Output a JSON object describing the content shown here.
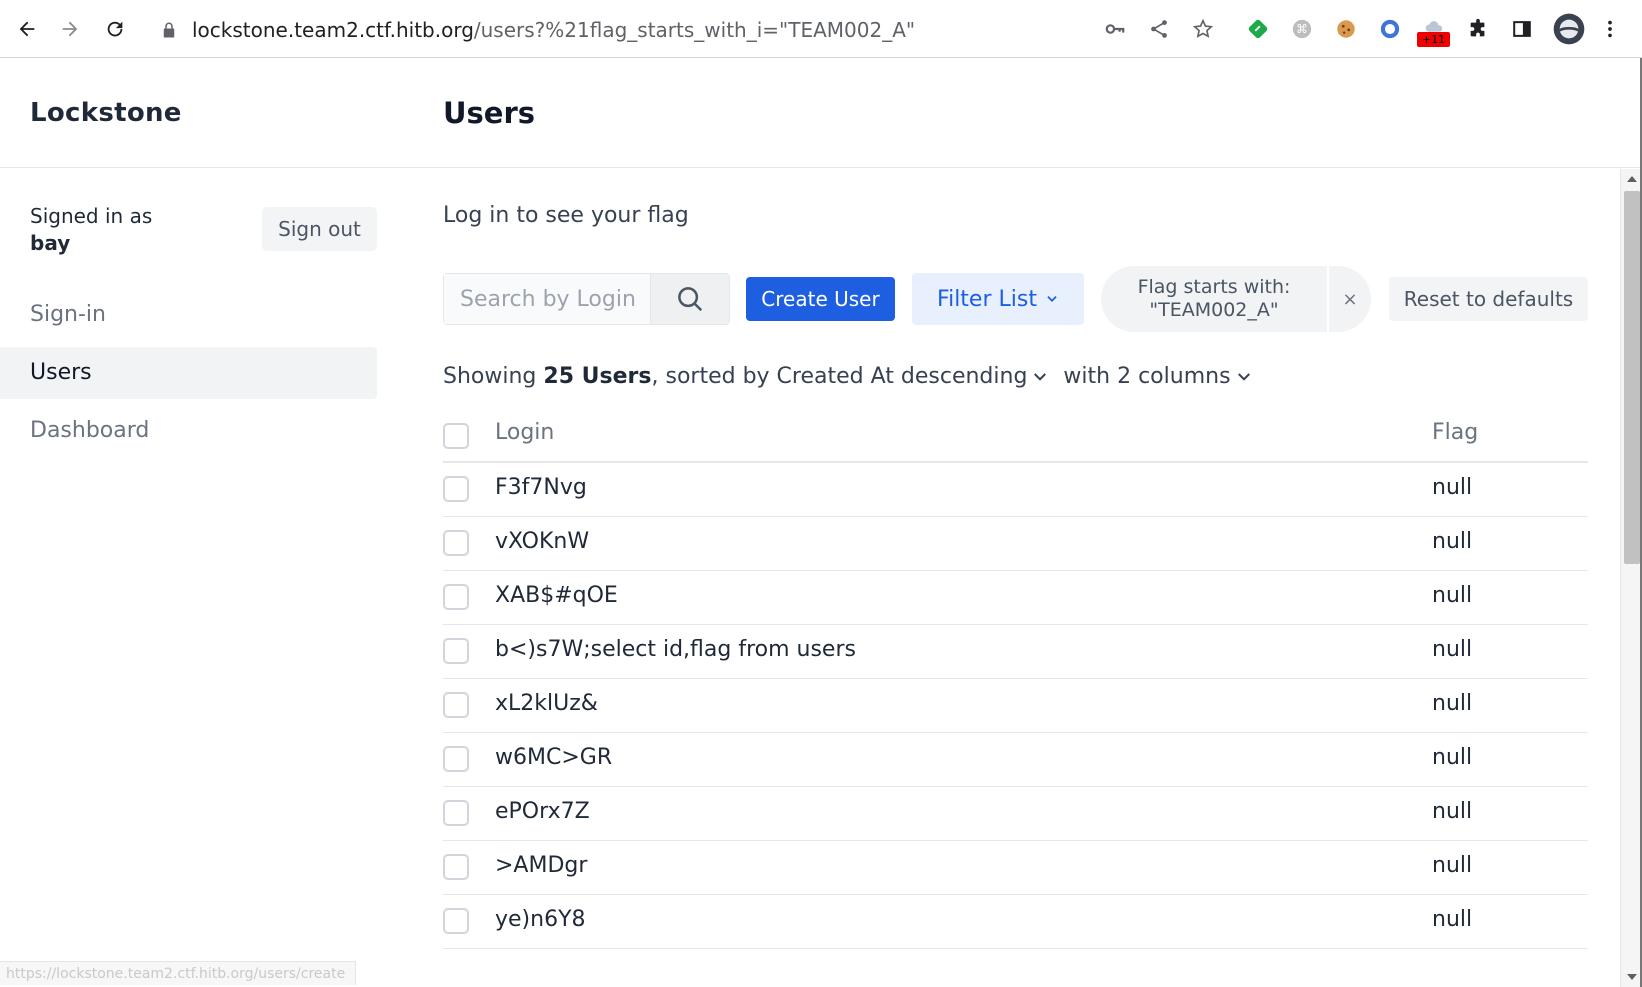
{
  "browser": {
    "url_host": "lockstone.team2.ctf.hitb.org",
    "url_path": "/users?%21flag_starts_with_i=\"TEAM002_A\"",
    "extension_badge": "+11",
    "status_link": "https://lockstone.team2.ctf.hitb.org/users/create"
  },
  "app": {
    "brand": "Lockstone",
    "page_title": "Users"
  },
  "sidebar": {
    "signed_in_prefix": "Signed in as",
    "username": "bay",
    "sign_out_label": "Sign out",
    "items": [
      {
        "label": "Sign-in",
        "active": false
      },
      {
        "label": "Users",
        "active": true
      },
      {
        "label": "Dashboard",
        "active": false
      }
    ]
  },
  "main": {
    "notice": "Log in to see your flag",
    "search_placeholder": "Search by Login",
    "create_label": "Create User",
    "filter_label": "Filter List",
    "filter_chip": {
      "line1": "Flag starts with:",
      "line2": "\"TEAM002_A\"",
      "remove": "×"
    },
    "reset_label": "Reset to defaults",
    "summary": {
      "prefix": "Showing",
      "count": "25 Users",
      "sort_text": ", sorted by Created At descending",
      "columns_text": "with 2 columns"
    }
  },
  "table": {
    "headers": {
      "login": "Login",
      "flag": "Flag"
    },
    "rows": [
      {
        "login": "F3f7Nvg",
        "flag": "null"
      },
      {
        "login": "vXOKnW",
        "flag": "null"
      },
      {
        "login": "XAB$#qOE",
        "flag": "null"
      },
      {
        "login": "b<)s7W;select id,flag from users",
        "flag": "null"
      },
      {
        "login": "xL2klUz&",
        "flag": "null"
      },
      {
        "login": "w6MC>GR",
        "flag": "null"
      },
      {
        "login": "ePOrx7Z",
        "flag": "null"
      },
      {
        "login": ">AMDgr",
        "flag": "null"
      },
      {
        "login": "ye)n6Y8",
        "flag": "null"
      }
    ]
  },
  "colors": {
    "primary": "#1d5fe0",
    "filter_bg": "#e8f0fd",
    "active_bg": "#f1f3f5"
  }
}
